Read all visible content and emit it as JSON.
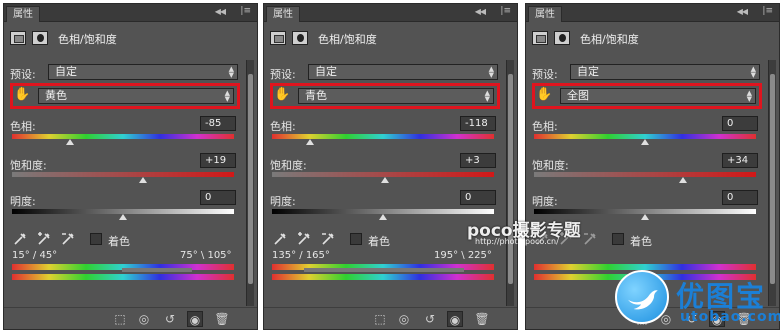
{
  "panels": [
    {
      "tab_label": "属性",
      "header_title": "色相/饱和度",
      "preset_label": "预设:",
      "preset_value": "自定",
      "channel_value": "黄色",
      "hue_label": "色相:",
      "hue_value": "-85",
      "saturation_label": "饱和度:",
      "saturation_value": "+19",
      "lightness_label": "明度:",
      "lightness_value": "0",
      "colorize_label": "着色",
      "range_left": "15° / 45°",
      "range_right": "75° \\ 105°",
      "hue_level": 0.26,
      "saturation_level": 0.59,
      "lightness_level": 0.5
    },
    {
      "tab_label": "属性",
      "header_title": "色相/饱和度",
      "preset_label": "预设:",
      "preset_value": "自定",
      "channel_value": "青色",
      "hue_label": "色相:",
      "hue_value": "-118",
      "saturation_label": "饱和度:",
      "saturation_value": "+3",
      "lightness_label": "明度:",
      "lightness_value": "0",
      "colorize_label": "着色",
      "range_left": "135° / 165°",
      "range_right": "195° \\ 225°",
      "hue_level": 0.17,
      "saturation_level": 0.51,
      "lightness_level": 0.5
    },
    {
      "tab_label": "属性",
      "header_title": "色相/饱和度",
      "preset_label": "预设:",
      "preset_value": "自定",
      "channel_value": "全图",
      "hue_label": "色相:",
      "hue_value": "0",
      "saturation_label": "饱和度:",
      "saturation_value": "+34",
      "lightness_label": "明度:",
      "lightness_value": "0",
      "colorize_label": "着色",
      "range_left": "",
      "range_right": "",
      "hue_level": 0.5,
      "saturation_level": 0.67,
      "lightness_level": 0.5
    }
  ],
  "watermark": {
    "main": "poco摄影专题",
    "sub": "http://photo.poco.cn/"
  },
  "logo": {
    "name": "优图宝",
    "url": "utobao.com"
  },
  "colors": {
    "highlight": "#e0141e",
    "panel_bg": "#535353",
    "logo_blue": "#1b7fd6"
  }
}
